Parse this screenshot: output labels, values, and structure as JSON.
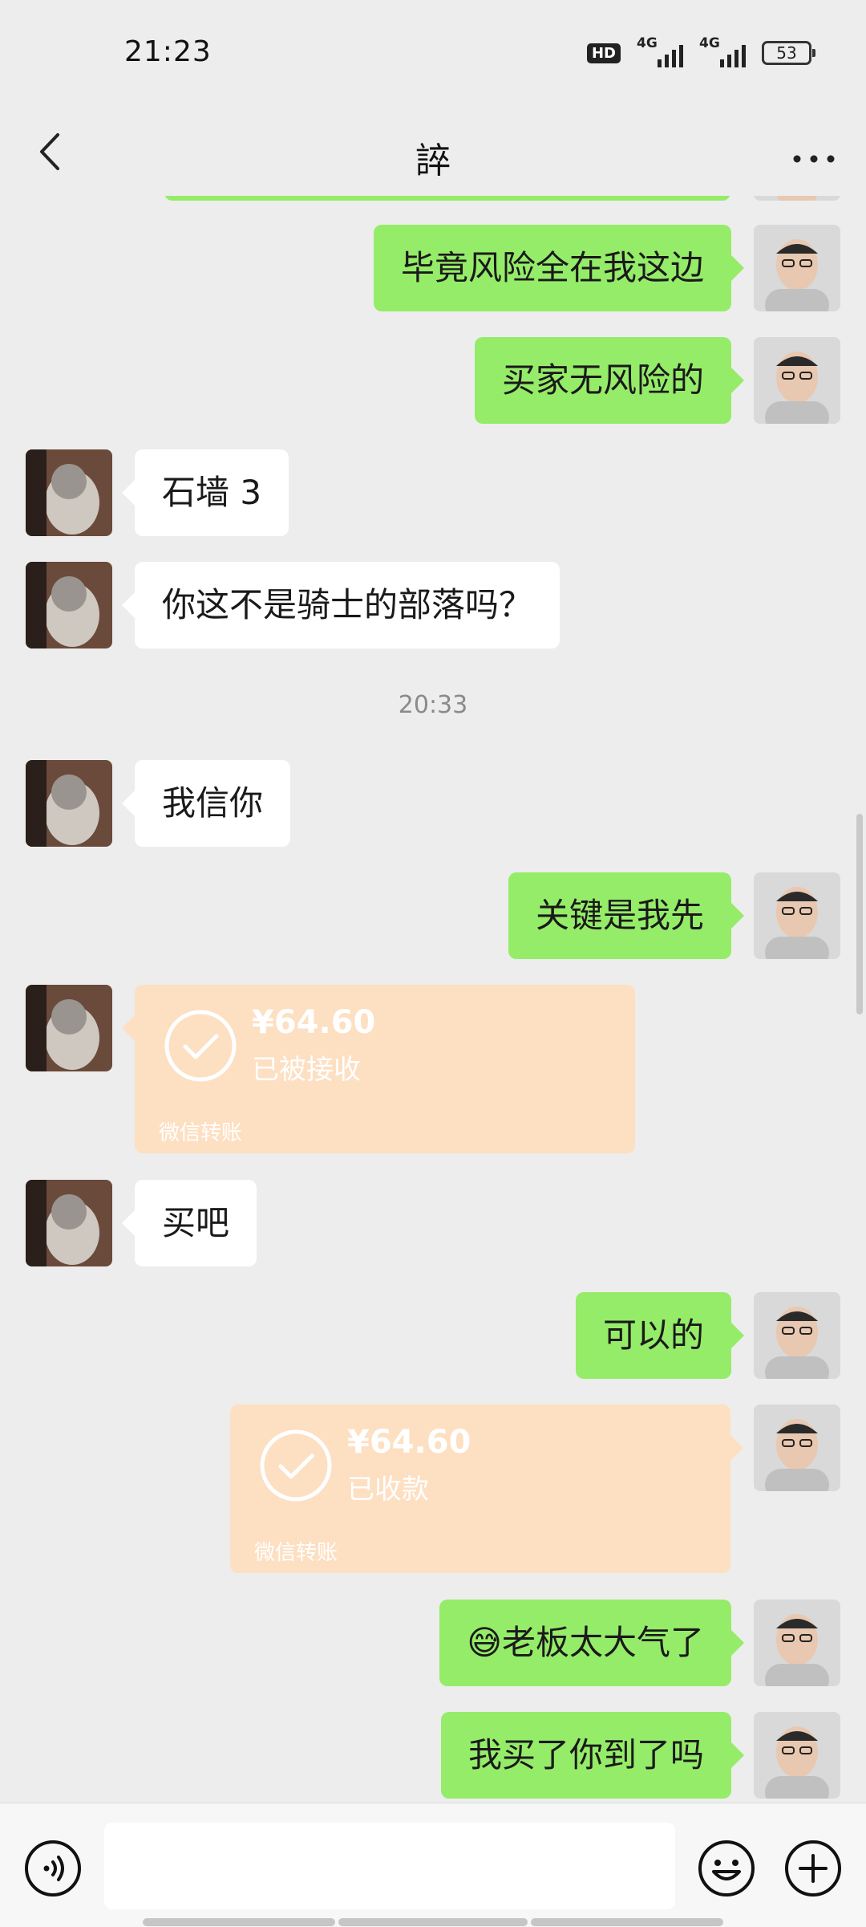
{
  "status_bar": {
    "time": "21:23",
    "hd_label": "HD",
    "network1": "4G",
    "network2": "4G",
    "battery": "53"
  },
  "header": {
    "title": "誶",
    "back_icon": "chevron-left-icon",
    "more_icon": "more-horizontal-icon"
  },
  "messages": [
    {
      "side": "me",
      "text": "毕竟风险全在我这边"
    },
    {
      "side": "me",
      "text": "买家无风险的"
    },
    {
      "side": "other",
      "text": "石墙 3"
    },
    {
      "side": "other",
      "text": "你这不是骑士的部落吗？"
    },
    {
      "type": "timestamp",
      "text": "20:33"
    },
    {
      "side": "other",
      "text": "我信你"
    },
    {
      "side": "me",
      "text": "关键是我先"
    },
    {
      "side": "other",
      "type": "transfer",
      "amount": "¥64.60",
      "status": "已被接收",
      "label": "微信转账"
    },
    {
      "side": "other",
      "text": "买吧"
    },
    {
      "side": "me",
      "text": "可以的"
    },
    {
      "side": "me",
      "type": "transfer",
      "amount": "¥64.60",
      "status": "已收款",
      "label": "微信转账"
    },
    {
      "side": "me",
      "text": "老板太大气了",
      "emoji": "😅"
    },
    {
      "side": "me",
      "text": "我买了你到了吗"
    }
  ],
  "input_bar": {
    "voice_icon": "voice-icon",
    "emoji_icon": "emoji-icon",
    "plus_icon": "plus-icon"
  },
  "colors": {
    "background": "#ededed",
    "my_bubble": "#95ec69",
    "other_bubble": "#ffffff",
    "transfer_card": "#fddfc2"
  }
}
